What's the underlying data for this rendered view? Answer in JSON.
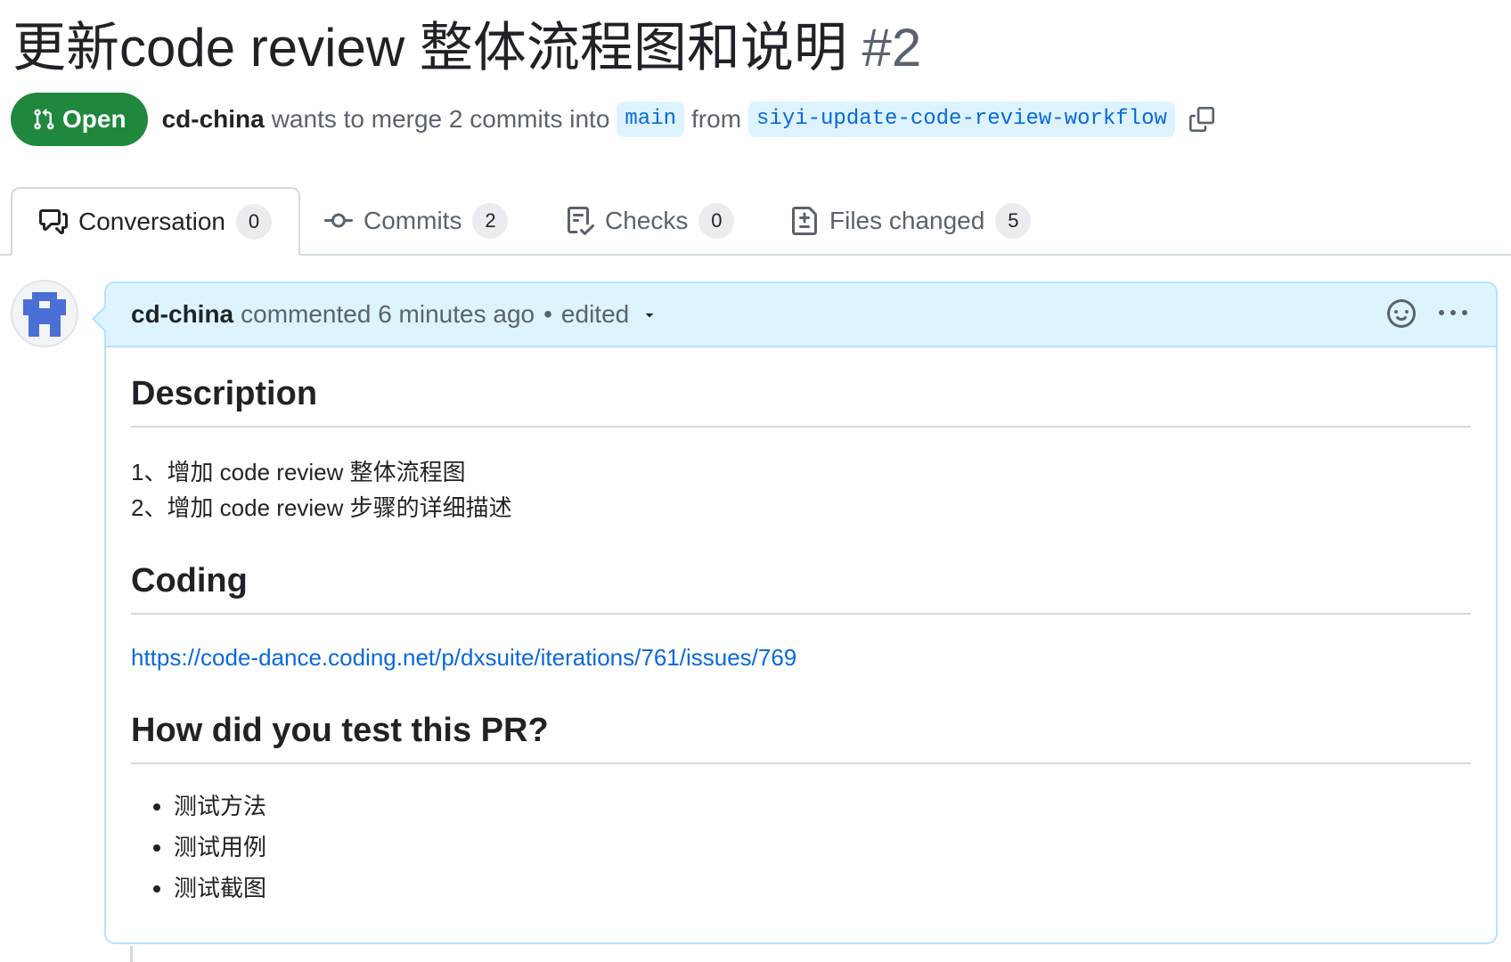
{
  "pr": {
    "title": "更新code review 整体流程图和说明",
    "number": "#2",
    "state": "Open",
    "author": "cd-china",
    "merge_text": "wants to merge 2 commits into",
    "base_branch": "main",
    "from_text": "from",
    "head_branch": "siyi-update-code-review-workflow"
  },
  "tabs": [
    {
      "label": "Conversation",
      "count": "0",
      "icon": "comment-discussion-icon"
    },
    {
      "label": "Commits",
      "count": "2",
      "icon": "git-commit-icon"
    },
    {
      "label": "Checks",
      "count": "0",
      "icon": "checklist-icon"
    },
    {
      "label": "Files changed",
      "count": "5",
      "icon": "file-diff-icon"
    }
  ],
  "comment": {
    "author": "cd-china",
    "action": "commented 6 minutes ago",
    "separator": "•",
    "edited": "edited",
    "sections": {
      "description": {
        "heading": "Description",
        "lines": [
          "1、增加 code review 整体流程图",
          "2、增加 code review 步骤的详细描述"
        ]
      },
      "coding": {
        "heading": "Coding",
        "link": "https://code-dance.coding.net/p/dxsuite/iterations/761/issues/769"
      },
      "testing": {
        "heading": "How did you test this PR?",
        "items": [
          "测试方法",
          "测试用例",
          "测试截图"
        ]
      }
    }
  },
  "colors": {
    "open_green": "#1f883d",
    "link_blue": "#0969da",
    "header_bg": "#ddf4ff",
    "comment_border": "#b6e3ff",
    "avatar_blue": "#4a6fd6"
  }
}
